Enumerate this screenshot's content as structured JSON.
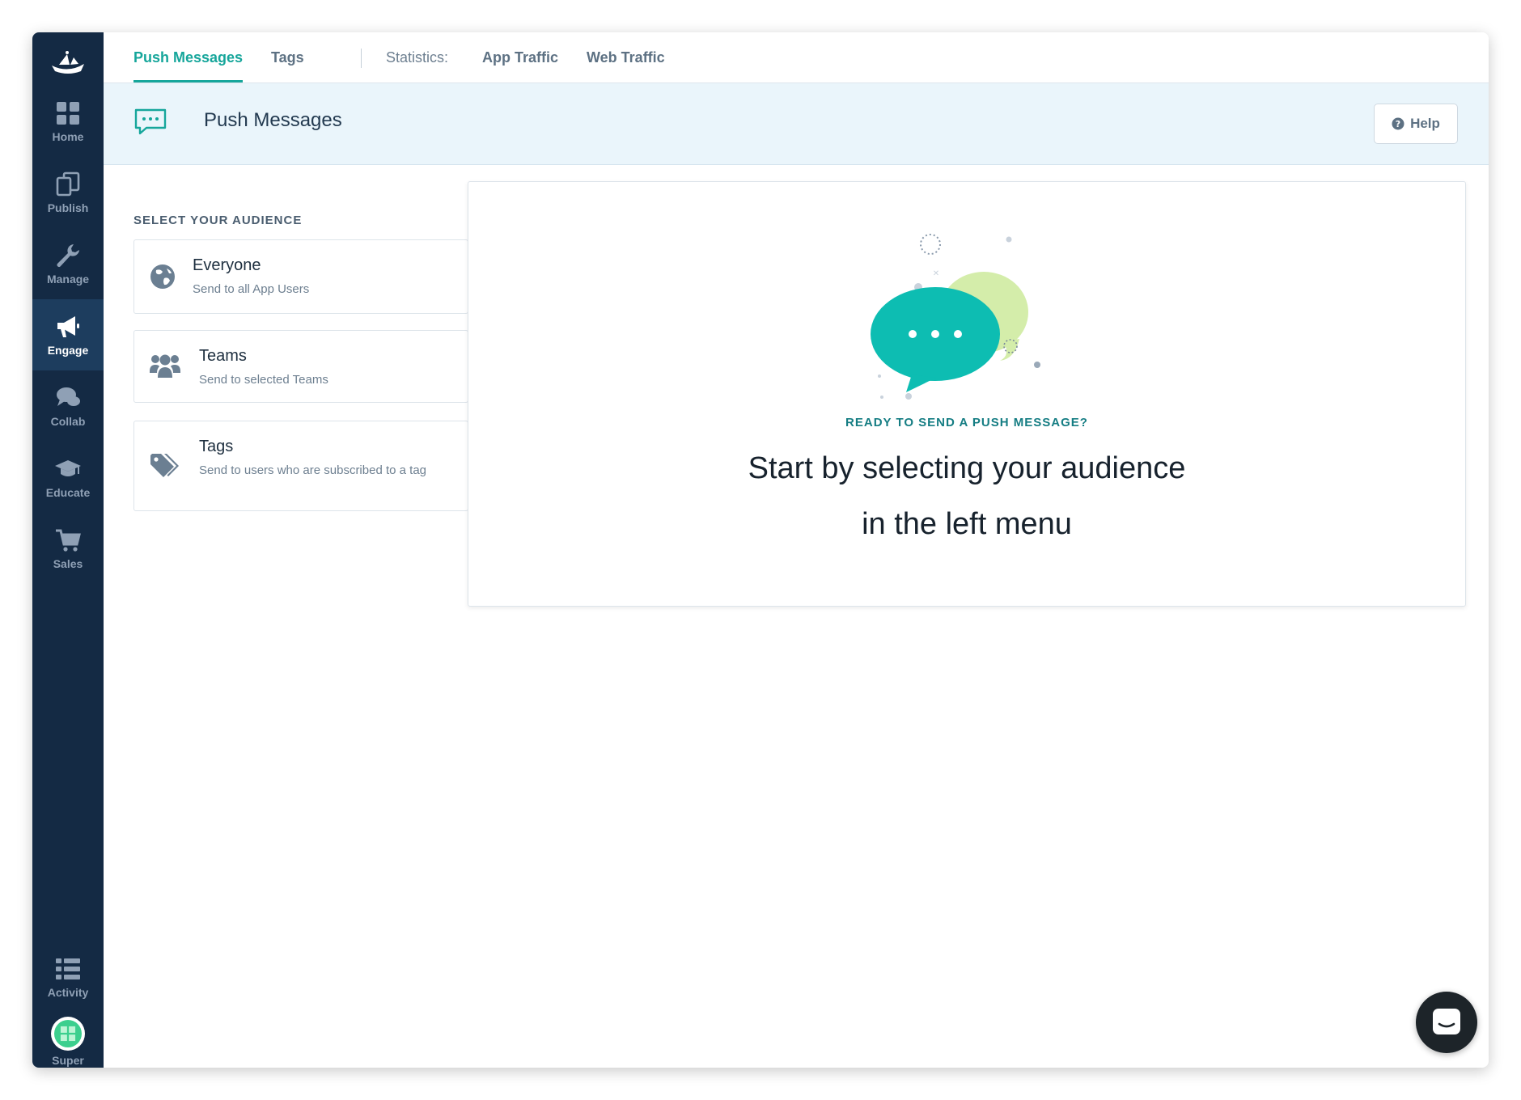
{
  "sidebar": {
    "items": [
      {
        "label": "Home",
        "icon": "grid-icon"
      },
      {
        "label": "Publish",
        "icon": "copy-icon"
      },
      {
        "label": "Manage",
        "icon": "wrench-icon"
      },
      {
        "label": "Engage",
        "icon": "megaphone-icon",
        "active": true
      },
      {
        "label": "Collab",
        "icon": "chat-icon"
      },
      {
        "label": "Educate",
        "icon": "graduation-cap-icon"
      },
      {
        "label": "Sales",
        "icon": "cart-icon"
      }
    ],
    "bottom": [
      {
        "label": "Activity",
        "icon": "list-icon"
      },
      {
        "label": "Super",
        "icon": "avatar"
      }
    ]
  },
  "tabs": {
    "push_messages": "Push Messages",
    "tags": "Tags",
    "statistics_label": "Statistics:",
    "app_traffic": "App Traffic",
    "web_traffic": "Web Traffic"
  },
  "header": {
    "title": "Push Messages",
    "help_label": "Help"
  },
  "audience": {
    "section_label": "SELECT YOUR AUDIENCE",
    "options": [
      {
        "title": "Everyone",
        "subtitle": "Send to all App Users",
        "icon": "globe-icon"
      },
      {
        "title": "Teams",
        "subtitle": "Send to selected Teams",
        "icon": "users-icon"
      },
      {
        "title": "Tags",
        "subtitle": "Send to users who are subscribed to a tag",
        "icon": "tag-icon"
      }
    ]
  },
  "empty_state": {
    "kicker": "READY TO SEND A PUSH MESSAGE?",
    "line1": "Start by selecting your audience",
    "line2": "in the left menu"
  },
  "colors": {
    "sidebar_bg": "#142a44",
    "sidebar_active": "#1d3d5e",
    "accent": "#16a69b",
    "header_bg": "#eaf5fb",
    "bubble_teal": "#0dbdb2",
    "bubble_lime": "#d4edaa"
  }
}
